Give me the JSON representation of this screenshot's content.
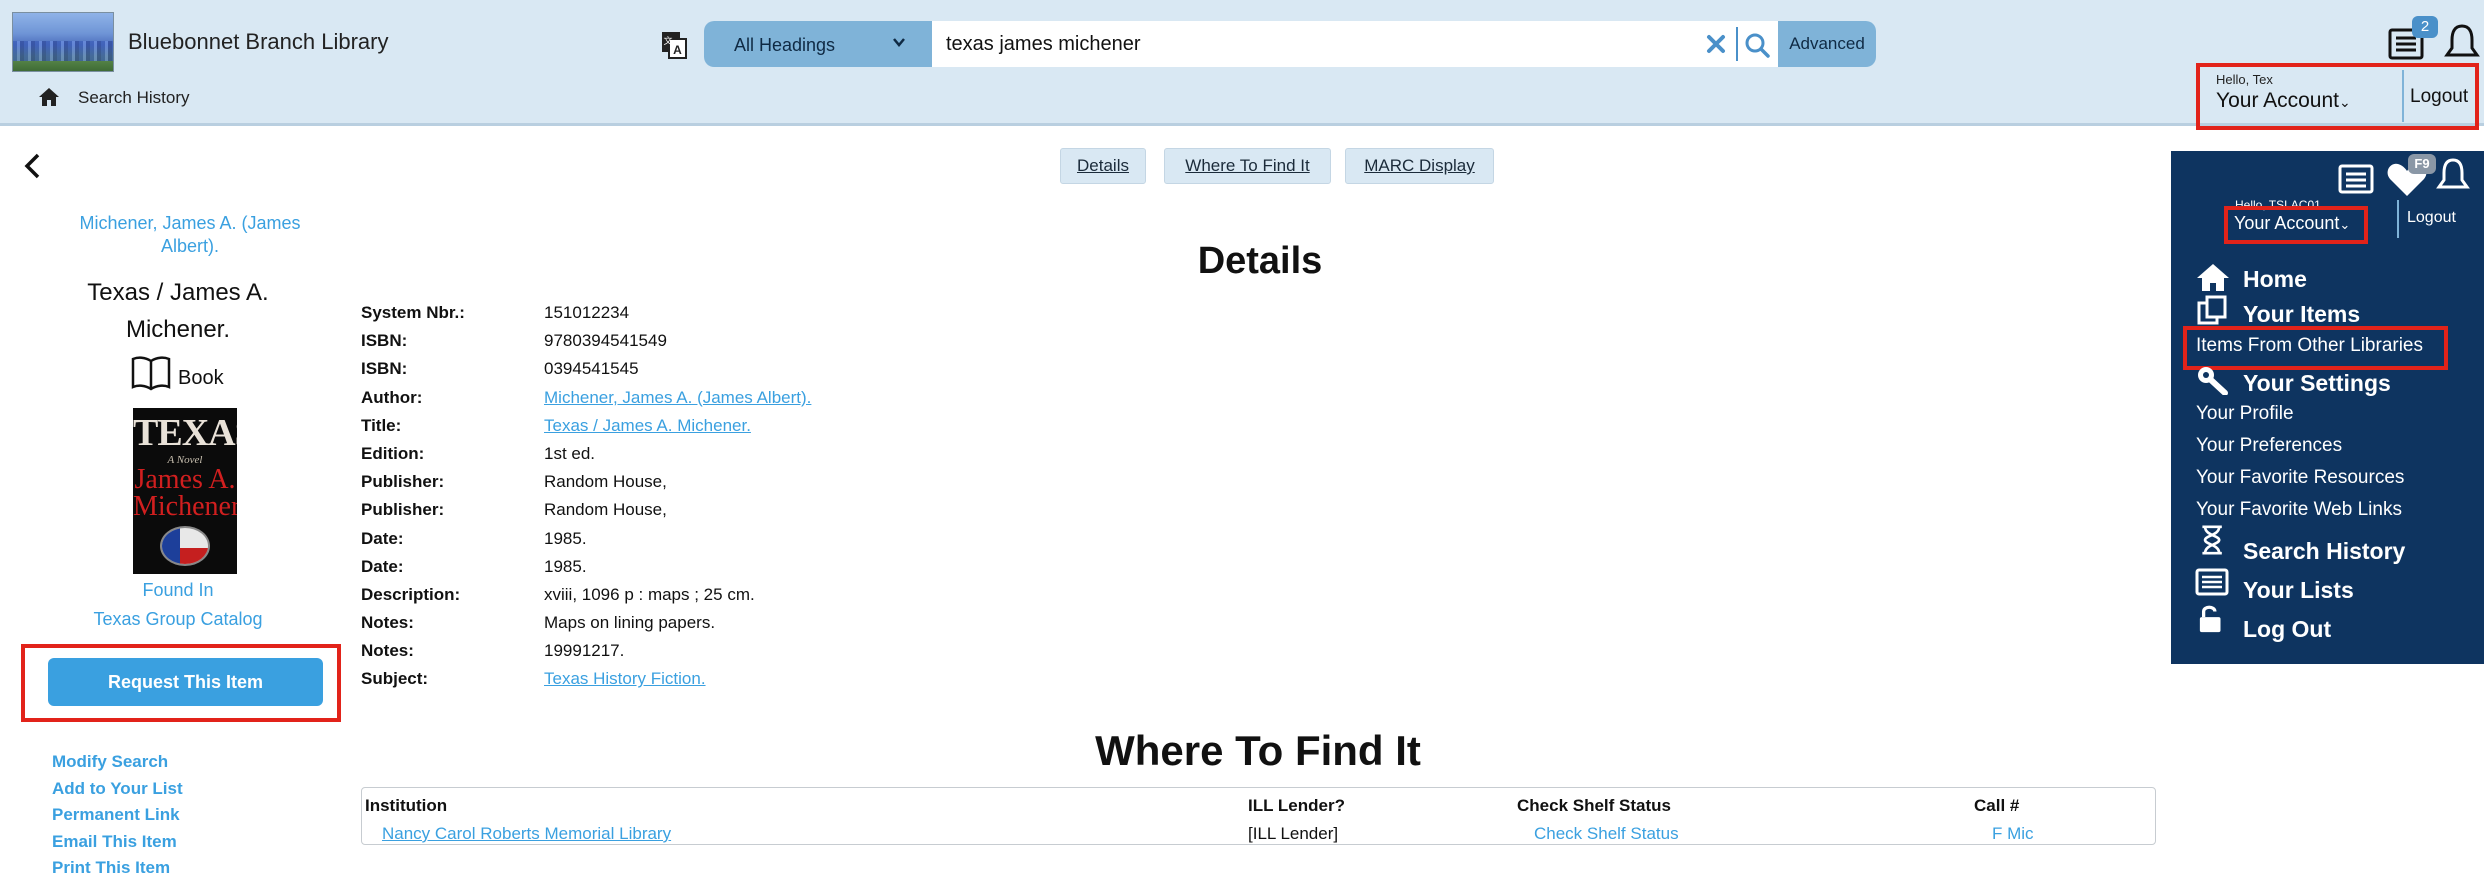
{
  "header": {
    "library_name": "Bluebonnet Branch Library",
    "search_history": "Search History",
    "heading_select": "All Headings",
    "search_value": "texas james michener",
    "advanced": "Advanced",
    "list_badge": "2",
    "hello": "Hello, Tex",
    "your_account": "Your Account",
    "logout": "Logout"
  },
  "left": {
    "author": "Michener, James A. (James Albert).",
    "title": "Texas / James A. Michener.",
    "format": "Book",
    "cover": {
      "line1": "TEXAS",
      "line2": "A Novel",
      "line3": "James A. Michener"
    },
    "found_in": "Found In",
    "catalog": "Texas Group Catalog",
    "request": "Request This Item",
    "links": [
      "Modify Search",
      "Add to Your List",
      "Permanent Link",
      "Email This Item",
      "Print This Item"
    ]
  },
  "tabs": [
    "Details",
    "Where To Find It",
    "MARC Display"
  ],
  "details": {
    "heading": "Details",
    "rows": [
      {
        "label": "System Nbr.:",
        "value": "151012234"
      },
      {
        "label": "ISBN:",
        "value": "9780394541549"
      },
      {
        "label": "ISBN:",
        "value": "0394541545"
      },
      {
        "label": "Author:",
        "value": "Michener, James A. (James Albert).",
        "link": true
      },
      {
        "label": "Title:",
        "value": "Texas / James A. Michener.",
        "link": true
      },
      {
        "label": "Edition:",
        "value": "1st ed."
      },
      {
        "label": "Publisher:",
        "value": "Random House,"
      },
      {
        "label": "Publisher:",
        "value": "Random House,"
      },
      {
        "label": "Date:",
        "value": "1985."
      },
      {
        "label": "Date:",
        "value": "1985."
      },
      {
        "label": "Description:",
        "value": "xviii, 1096 p : maps ; 25 cm."
      },
      {
        "label": "Notes:",
        "value": "Maps on lining papers."
      },
      {
        "label": "Notes:",
        "value": "19991217."
      },
      {
        "label": "Subject:",
        "value": "Texas History Fiction.",
        "link": true
      }
    ]
  },
  "where": {
    "heading": "Where To Find It",
    "columns": [
      "Institution",
      "ILL Lender?",
      "Check Shelf Status",
      "Call #"
    ],
    "row": [
      "Nancy Carol Roberts Memorial Library",
      "[ILL Lender]",
      "Check Shelf Status",
      "F Mic"
    ]
  },
  "panel": {
    "heart_badge": "F9",
    "hello": "Hello, TSLAC01",
    "your_account": "Your Account",
    "logout": "Logout",
    "home": "Home",
    "your_items": "Your Items",
    "items_other": "Items From Other Libraries",
    "your_settings": "Your Settings",
    "profile": "Your Profile",
    "preferences": "Your Preferences",
    "fav_resources": "Your Favorite Resources",
    "fav_links": "Your Favorite Web Links",
    "search_history": "Search History",
    "your_lists": "Your Lists",
    "log_out": "Log Out"
  },
  "colors": {
    "header_bg": "#d9e8f3",
    "accent": "#3aa0e0",
    "panel_bg": "#0e3460",
    "highlight_box": "#e2231a"
  }
}
